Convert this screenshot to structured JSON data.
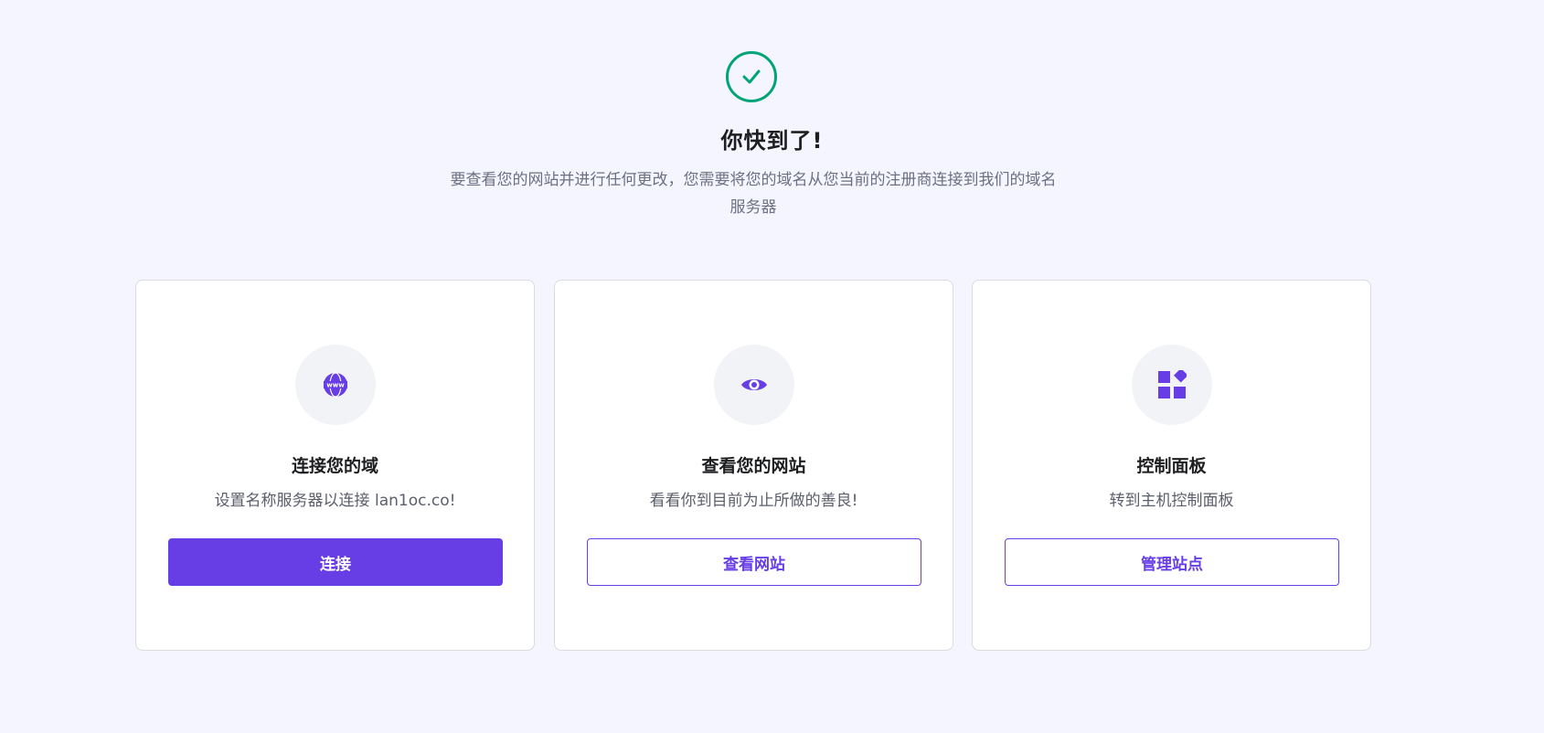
{
  "hero": {
    "icon": "check-circle-icon",
    "title": "你快到了!",
    "subtitle": "要查看您的网站并进行任何更改，您需要将您的域名从您当前的注册商连接到我们的域名服务器"
  },
  "cards": [
    {
      "icon": "www-globe-icon",
      "title": "连接您的域",
      "description": "设置名称服务器以连接 lan1oc.co!",
      "button_label": "连接",
      "button_style": "primary"
    },
    {
      "icon": "eye-icon",
      "title": "查看您的网站",
      "description": "看看你到目前为止所做的善良!",
      "button_label": "查看网站",
      "button_style": "outline"
    },
    {
      "icon": "widgets-icon",
      "title": "控制面板",
      "description": "转到主机控制面板",
      "button_label": "管理站点",
      "button_style": "outline"
    }
  ],
  "colors": {
    "accent": "#673de6",
    "success": "#00a37a",
    "background": "#f4f5ff"
  }
}
